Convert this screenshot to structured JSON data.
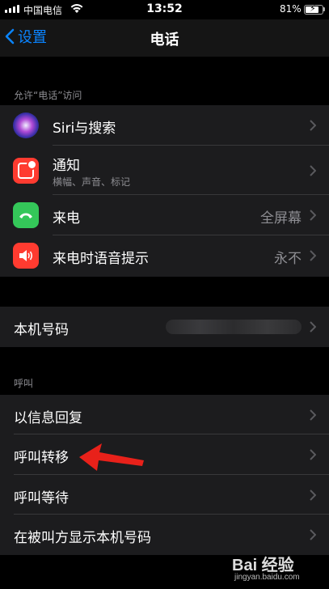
{
  "status_bar": {
    "carrier": "中国电信",
    "time": "13:52",
    "battery_pct": "81%",
    "battery_level": 0.81
  },
  "nav": {
    "back_label": "设置",
    "title": "电话"
  },
  "section_access": {
    "header": "允许“电话”访问",
    "items": [
      {
        "label": "Siri与搜索",
        "icon": "siri-icon"
      },
      {
        "label": "通知",
        "sublabel": "横幅、声音、标记",
        "icon": "notifications-icon"
      },
      {
        "label": "来电",
        "value": "全屏幕",
        "icon": "phone-icon"
      },
      {
        "label": "来电时语音提示",
        "value": "永不",
        "icon": "speaker-icon"
      }
    ]
  },
  "my_number": {
    "label": "本机号码"
  },
  "section_calls": {
    "header": "呼叫",
    "items": [
      {
        "label": "以信息回复"
      },
      {
        "label": "呼叫转移"
      },
      {
        "label": "呼叫等待"
      },
      {
        "label": "在被叫方显示本机号码"
      }
    ]
  },
  "watermark": {
    "brand": "Bai 经验",
    "url": "jingyan.baidu.com"
  },
  "colors": {
    "accent": "#0a84ff",
    "annotation_arrow": "#e8211a"
  }
}
